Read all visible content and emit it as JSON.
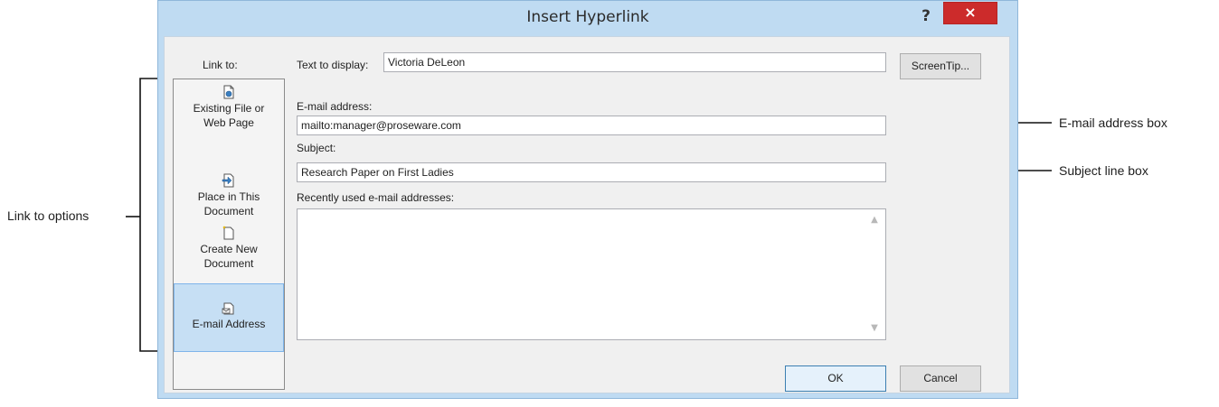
{
  "dialog": {
    "title": "Insert Hyperlink",
    "help_glyph": "?",
    "close_glyph": "×"
  },
  "link_to": {
    "label": "Link to:",
    "items": [
      {
        "label_line1": "Existing File or",
        "label_line2": "Web Page",
        "icon": "existing-file-icon",
        "selected": false
      },
      {
        "label_line1": "Place in This",
        "label_line2": "Document",
        "icon": "place-in-document-icon",
        "selected": false
      },
      {
        "label_line1": "Create New",
        "label_line2": "Document",
        "icon": "create-new-document-icon",
        "selected": false
      },
      {
        "label_line1": "E-mail Address",
        "label_line2": "",
        "icon": "email-address-icon",
        "selected": true
      }
    ]
  },
  "text_to_display": {
    "label": "Text to display:",
    "value": "Victoria DeLeon"
  },
  "screentip_button": "ScreenTip...",
  "email_address": {
    "label": "E-mail address:",
    "value": "mailto:manager@proseware.com"
  },
  "subject": {
    "label": "Subject:",
    "value": "Research Paper on First Ladies"
  },
  "recent_emails": {
    "label": "Recently used e-mail addresses:",
    "items": []
  },
  "buttons": {
    "ok": "OK",
    "cancel": "Cancel"
  },
  "annotations": {
    "link_to_options": "Link to options",
    "email_address_box": "E-mail address box",
    "subject_line_box": "Subject line box"
  },
  "colors": {
    "dialog_frame": "#bfdbf2",
    "selected_item": "#c6dff4",
    "close_button": "#cc2b2b"
  }
}
